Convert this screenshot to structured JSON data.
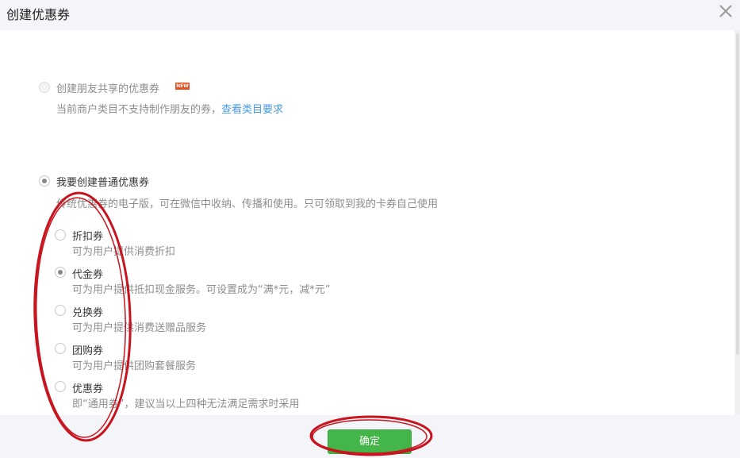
{
  "dialog": {
    "title": "创建优惠券",
    "close_label": "×"
  },
  "friend_coupon": {
    "label": "创建朋友共享的优惠券",
    "badge": "NEW",
    "note": "当前商户类目不支持制作朋友的券，",
    "link": "查看类目要求",
    "checked": false,
    "disabled": true
  },
  "normal_coupon": {
    "label": "我要创建普通优惠券",
    "desc": "传统优惠券的电子版，可在微信中收纳、传播和使用。只可领取到我的卡券自己使用",
    "checked": true
  },
  "coupon_types": [
    {
      "label": "折扣券",
      "desc": "可为用户提供消费折扣",
      "checked": false
    },
    {
      "label": "代金券",
      "desc": "可为用户提供抵扣现金服务。可设置成为“满*元，减*元”",
      "checked": true
    },
    {
      "label": "兑换券",
      "desc": "可为用户提供消费送赠品服务",
      "checked": false
    },
    {
      "label": "团购券",
      "desc": "可为用户提供团购套餐服务",
      "checked": false
    },
    {
      "label": "优惠券",
      "desc": "即“通用券”，建议当以上四种无法满足需求时采用",
      "checked": false
    }
  ],
  "footer": {
    "confirm_label": "确定"
  },
  "colors": {
    "accent_green": "#44b549",
    "link_blue": "#459ae9",
    "annotation_red": "#c8141e",
    "badge_red": "#e2501f"
  }
}
